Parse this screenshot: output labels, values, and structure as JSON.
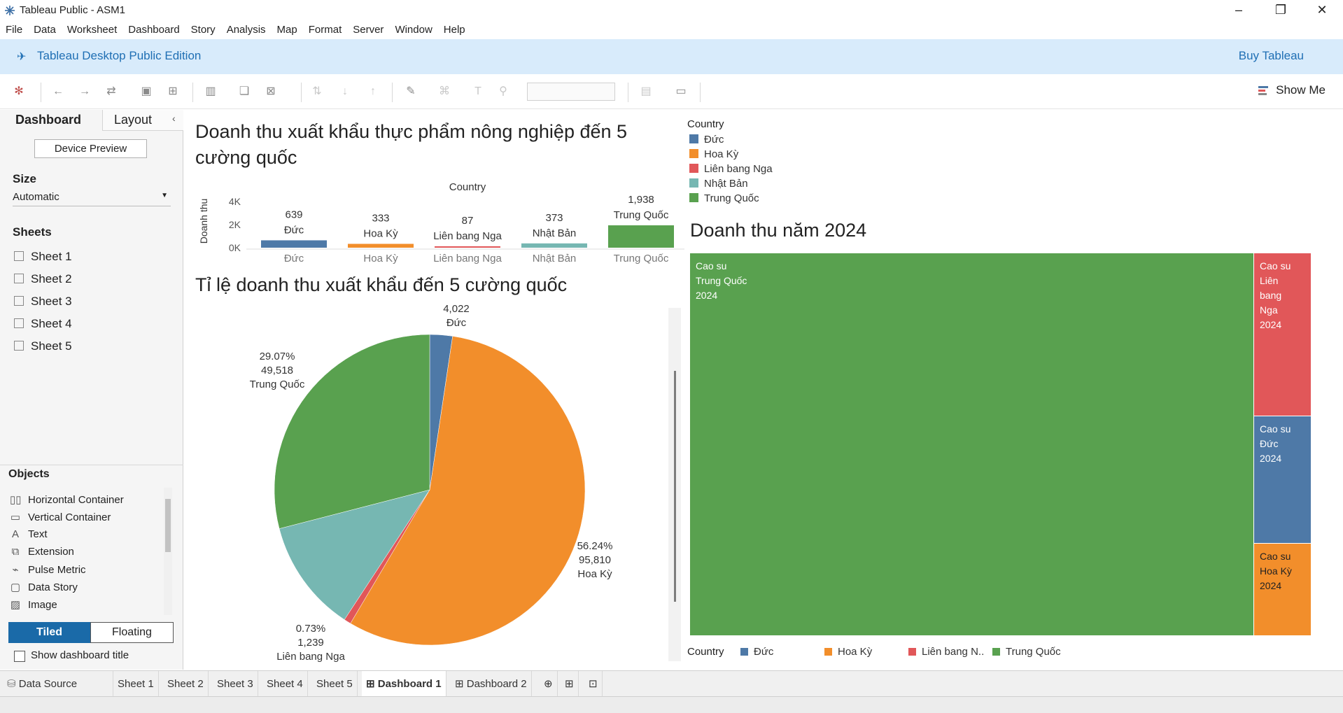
{
  "window": {
    "title": "Tableau Public - ASM1"
  },
  "menu": [
    "File",
    "Data",
    "Worksheet",
    "Dashboard",
    "Story",
    "Analysis",
    "Map",
    "Format",
    "Server",
    "Window",
    "Help"
  ],
  "banner": {
    "label": "Tableau Desktop Public Edition",
    "buy": "Buy Tableau"
  },
  "toolbar": {
    "show_me": "Show Me"
  },
  "left_panel": {
    "tab_dashboard": "Dashboard",
    "tab_layout": "Layout",
    "device_preview": "Device Preview",
    "size_title": "Size",
    "size_value": "Automatic",
    "sheets_title": "Sheets",
    "sheets": [
      "Sheet 1",
      "Sheet 2",
      "Sheet 3",
      "Sheet 4",
      "Sheet 5"
    ],
    "objects_title": "Objects",
    "objects": [
      "Horizontal Container",
      "Vertical Container",
      "Text",
      "Extension",
      "Pulse Metric",
      "Data Story",
      "Image"
    ],
    "tiled": "Tiled",
    "floating": "Floating",
    "show_title": "Show dashboard title"
  },
  "dashboard": {
    "bar_title": "Doanh thu xuất khẩu thực phẩm nông nghiệp đến 5 cường quốc",
    "pie_title": "Tỉ lệ doanh thu xuất khẩu đến 5 cường quốc",
    "treemap_title": "Doanh thu năm 2024",
    "legend_title": "Country",
    "legend": [
      {
        "name": "Đức",
        "color": "#4e79a7"
      },
      {
        "name": "Hoa Kỳ",
        "color": "#f28e2b"
      },
      {
        "name": "Liên bang Nga",
        "color": "#e15759"
      },
      {
        "name": "Nhật Bản",
        "color": "#76b7b2"
      },
      {
        "name": "Trung Quốc",
        "color": "#59a14f"
      }
    ],
    "bottom_legend_title": "Country",
    "bottom_legend": [
      {
        "name": "Đức",
        "color": "#4e79a7"
      },
      {
        "name": "Hoa Kỳ",
        "color": "#f28e2b"
      },
      {
        "name": "Liên bang N..",
        "color": "#e15759"
      },
      {
        "name": "Trung Quốc",
        "color": "#59a14f"
      }
    ]
  },
  "chart_data": [
    {
      "type": "bar",
      "title": "Doanh thu xuất khẩu thực phẩm nông nghiệp đến 5 cường quốc",
      "xlabel": "Country",
      "ylabel": "Doanh thu",
      "categories": [
        "Đức",
        "Hoa Kỳ",
        "Liên bang Nga",
        "Nhật Bản",
        "Trung Quốc"
      ],
      "values": [
        639,
        333,
        87,
        373,
        1938
      ],
      "value_labels": [
        "639",
        "333",
        "87",
        "373",
        "1,938"
      ],
      "colors": [
        "#4e79a7",
        "#f28e2b",
        "#e15759",
        "#76b7b2",
        "#59a14f"
      ],
      "yticks": [
        "4K",
        "2K",
        "0K"
      ],
      "ylim": [
        0,
        4000
      ]
    },
    {
      "type": "pie",
      "title": "Tỉ lệ doanh thu xuất khẩu đến 5 cường quốc",
      "slices": [
        {
          "name": "Đức",
          "value": 4022,
          "color": "#4e79a7",
          "label": [
            "4,022",
            "Đức"
          ]
        },
        {
          "name": "Hoa Kỳ",
          "value": 95810,
          "color": "#f28e2b",
          "label": [
            "56.24%",
            "95,810",
            "Hoa Kỳ"
          ]
        },
        {
          "name": "Liên bang Nga",
          "value": 1239,
          "color": "#e15759",
          "label": [
            "0.73%",
            "1,239",
            "Liên bang Nga"
          ]
        },
        {
          "name": "Nhật Bản",
          "value": 20000,
          "color": "#76b7b2",
          "label": []
        },
        {
          "name": "Trung Quốc",
          "value": 49518,
          "color": "#59a14f",
          "label": [
            "29.07%",
            "49,518",
            "Trung Quốc"
          ]
        }
      ]
    },
    {
      "type": "treemap",
      "title": "Doanh thu năm 2024",
      "cells": [
        {
          "lines": [
            "Cao su",
            "Trung Quốc",
            "2024"
          ],
          "color": "#59a14f"
        },
        {
          "lines": [
            "Cao su",
            "Liên",
            "bang",
            "Nga",
            "2024"
          ],
          "color": "#e15759"
        },
        {
          "lines": [
            "Cao su",
            "Đức",
            "2024"
          ],
          "color": "#4e79a7"
        },
        {
          "lines": [
            "Cao su",
            "Hoa Kỳ",
            "2024"
          ],
          "color": "#f28e2b"
        }
      ]
    }
  ],
  "bottom_tabs": [
    "Data Source",
    "Sheet 1",
    "Sheet 2",
    "Sheet 3",
    "Sheet 4",
    "Sheet 5",
    "Dashboard 1",
    "Dashboard 2"
  ],
  "active_tab": "Dashboard 1"
}
